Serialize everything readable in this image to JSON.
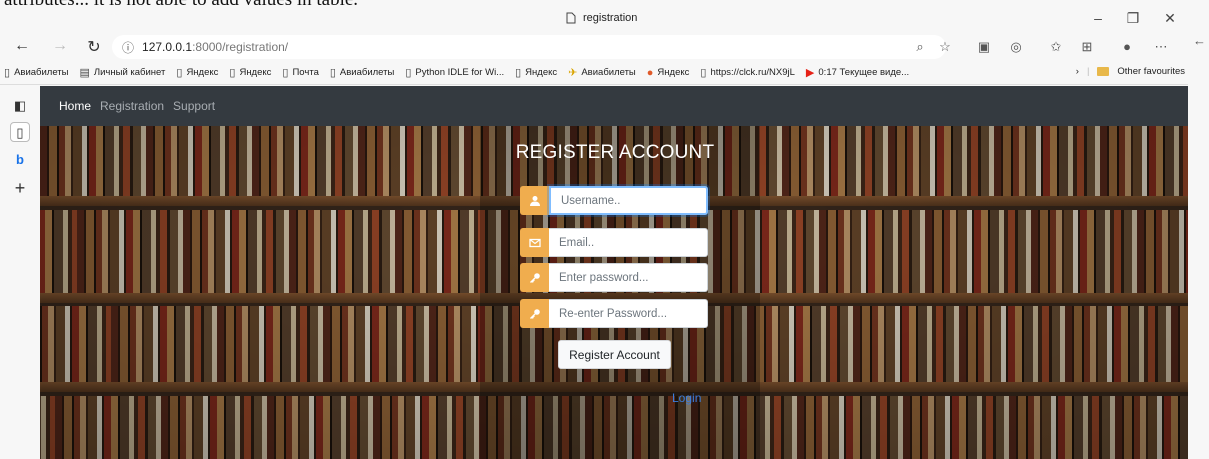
{
  "caption_text": "attributes... it is not able to add values in table.",
  "window": {
    "title": "registration",
    "minimize_symbol": "–",
    "maximize_symbol": "❐",
    "close_symbol": "✕"
  },
  "address_bar": {
    "host": "127.0.0.1",
    "path": ":8000/registration/"
  },
  "bookmarks": [
    {
      "label": "Авиабилеты",
      "icon": "page-icon"
    },
    {
      "label": "Личный кабинет",
      "icon": "cabinet-icon"
    },
    {
      "label": "Яндекс",
      "icon": "page-icon"
    },
    {
      "label": "Яндекс",
      "icon": "page-icon"
    },
    {
      "label": "Почта",
      "icon": "page-icon"
    },
    {
      "label": "Авиабилеты",
      "icon": "page-icon"
    },
    {
      "label": "Python IDLE for Wi...",
      "icon": "page-icon"
    },
    {
      "label": "Яндекс",
      "icon": "page-icon"
    },
    {
      "label": "Авиабилеты",
      "icon": "plane-icon"
    },
    {
      "label": "Яндекс",
      "icon": "yandex-icon"
    },
    {
      "label": "https://clck.ru/NX9jL",
      "icon": "page-icon"
    },
    {
      "label": "0:17 Текущее виде...",
      "icon": "youtube-icon"
    }
  ],
  "other_favourites": "Other favourites",
  "page_nav": {
    "home": "Home",
    "registration": "Registration",
    "support": "Support"
  },
  "form": {
    "title": "REGISTER ACCOUNT",
    "username_placeholder": "Username..",
    "email_placeholder": "Email..",
    "password_placeholder": "Enter password...",
    "repassword_placeholder": "Re-enter Password...",
    "submit_label": "Register Account",
    "login_label": "Login"
  },
  "colors": {
    "addon": "#f0ad4e",
    "navbar": "#343a40",
    "link": "#3b7ddd"
  }
}
